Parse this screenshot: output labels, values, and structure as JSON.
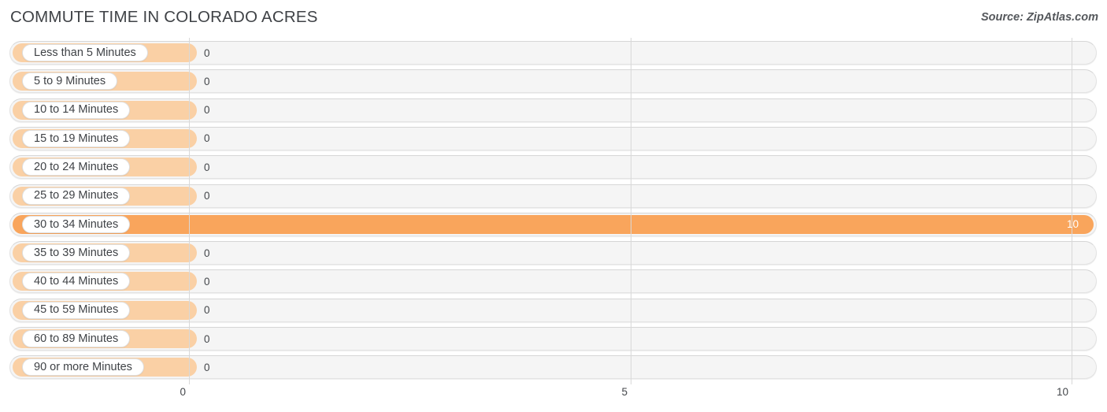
{
  "header": {
    "title": "COMMUTE TIME IN COLORADO ACRES",
    "source": "Source: ZipAtlas.com"
  },
  "colors": {
    "bar_zero": "#fad0a5",
    "bar_filled": "#f9a55c",
    "track": "#f5f5f5",
    "gridline": "#d8d8d8",
    "text": "#3f4246"
  },
  "chart_data": {
    "type": "bar",
    "orientation": "horizontal",
    "title": "COMMUTE TIME IN COLORADO ACRES",
    "xlabel": "",
    "ylabel": "",
    "xlim": [
      0,
      10
    ],
    "xticks": [
      "0",
      "5",
      "10"
    ],
    "grid": true,
    "legend": null,
    "categories": [
      "Less than 5 Minutes",
      "5 to 9 Minutes",
      "10 to 14 Minutes",
      "15 to 19 Minutes",
      "20 to 24 Minutes",
      "25 to 29 Minutes",
      "30 to 34 Minutes",
      "35 to 39 Minutes",
      "40 to 44 Minutes",
      "45 to 59 Minutes",
      "60 to 89 Minutes",
      "90 or more Minutes"
    ],
    "values": [
      0,
      0,
      0,
      0,
      0,
      0,
      10,
      0,
      0,
      0,
      0,
      0
    ],
    "value_labels": [
      "0",
      "0",
      "0",
      "0",
      "0",
      "0",
      "10",
      "0",
      "0",
      "0",
      "0",
      "0"
    ]
  }
}
